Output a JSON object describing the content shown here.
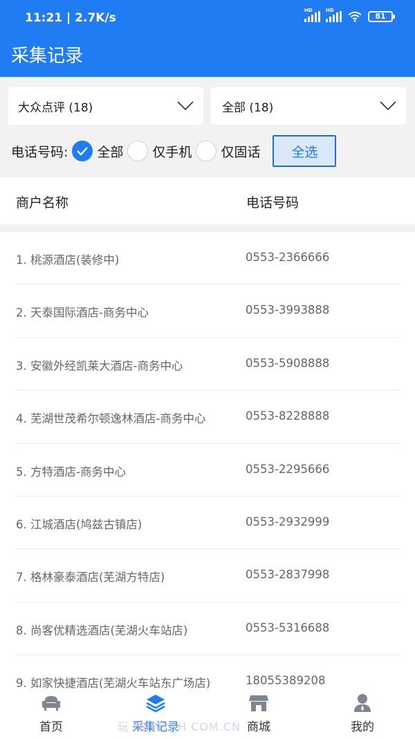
{
  "status_bar": {
    "time": "11:21 | 2.7K/s",
    "battery": "81",
    "signal_label": "HD"
  },
  "header": {
    "title": "采集记录"
  },
  "filters": {
    "source_select": "大众点评 (18)",
    "category_select": "全部 (18)",
    "phone_label": "电话号码:",
    "options": [
      "全部",
      "仅手机",
      "仅固话"
    ],
    "select_all": "全选"
  },
  "table": {
    "headers": [
      "商户名称",
      "电话号码"
    ],
    "rows": [
      {
        "name": "1. 桃源酒店(装修中)",
        "phone": "0553-2366666"
      },
      {
        "name": "2. 天泰国际酒店-商务中心",
        "phone": "0553-3993888"
      },
      {
        "name": "3. 安徽外经凯莱大酒店-商务中心",
        "phone": "0553-5908888"
      },
      {
        "name": "4. 芜湖世茂希尔顿逸林酒店-商务中心",
        "phone": "0553-8228888"
      },
      {
        "name": "5. 方特酒店-商务中心",
        "phone": "0553-2295666"
      },
      {
        "name": "6. 江城酒店(鸠兹古镇店)",
        "phone": "0553-2932999"
      },
      {
        "name": "7. 格林豪泰酒店(芜湖方特店)",
        "phone": "0553-2837998"
      },
      {
        "name": "8. 尚客优精选酒店(芜湖火车站店)",
        "phone": "0553-5316688"
      },
      {
        "name": "9. 如家快捷酒店(芜湖火车站东广场店)",
        "phone": "18055389208"
      }
    ]
  },
  "tabbar": {
    "tabs": [
      {
        "label": "首页",
        "icon": "sofa-icon"
      },
      {
        "label": "采集记录",
        "icon": "layers-icon"
      },
      {
        "label": "商城",
        "icon": "store-icon"
      },
      {
        "label": "我的",
        "icon": "user-icon"
      }
    ]
  },
  "watermark": "玩 NBWYXH COM.CN",
  "colors": {
    "accent": "#1f7cf2",
    "text": "#222222",
    "muted": "#666666"
  }
}
